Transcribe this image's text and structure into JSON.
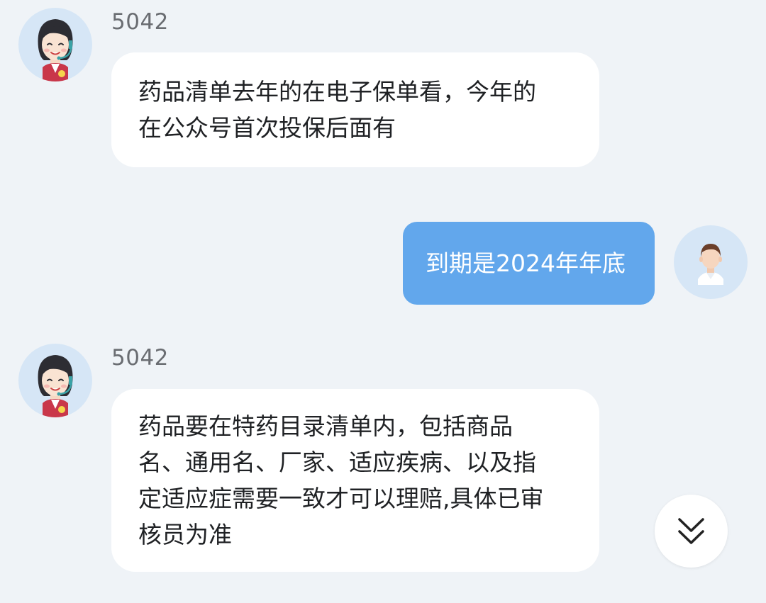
{
  "messages": [
    {
      "side": "left",
      "sender": "5042",
      "avatar_icon": "customer-service-agent-avatar",
      "lines": [
        "药品清单去年的在电子保单看，今年的",
        "在公众号首次投保后面有"
      ]
    },
    {
      "side": "right",
      "avatar_icon": "user-avatar",
      "lines": [
        "到期是2024年年底"
      ]
    },
    {
      "side": "left",
      "sender": "5042",
      "avatar_icon": "customer-service-agent-avatar",
      "lines": [
        "药品要在特药目录清单内，包括商品",
        "名、通用名、厂家、适应疾病、以及指",
        "定适应症需要一致才可以理赔,具体已审",
        "核员为准"
      ]
    }
  ],
  "scroll_button": {
    "icon": "double-chevron-down-icon"
  },
  "colors": {
    "background": "#eff3f7",
    "incoming_bubble": "#ffffff",
    "outgoing_bubble": "#62a7ec",
    "avatar_bg": "#d6e6f6"
  }
}
